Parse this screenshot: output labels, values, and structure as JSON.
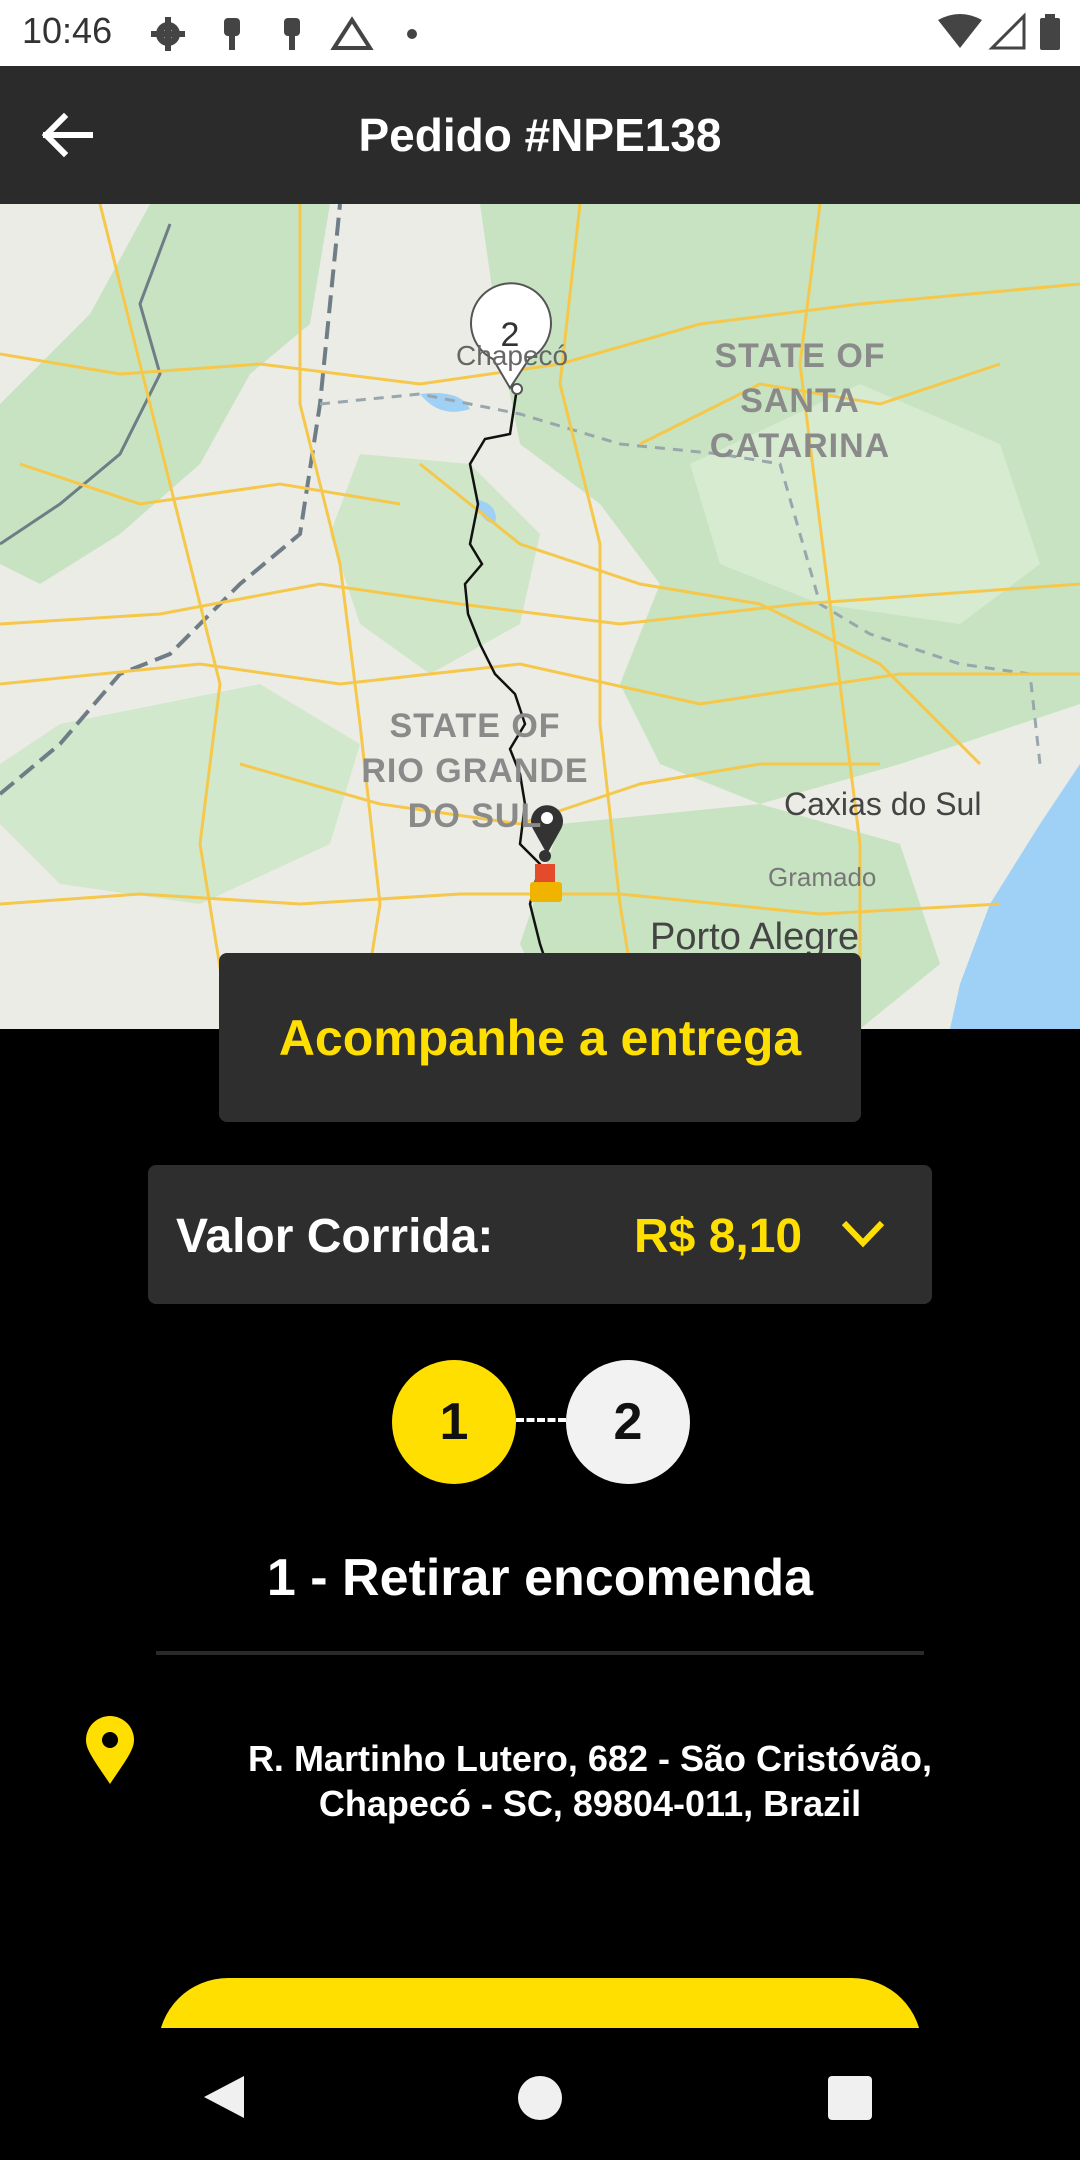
{
  "status_bar": {
    "time": "10:46",
    "icons_left": [
      "gear-icon",
      "notification-icon",
      "notification-icon",
      "drive-icon",
      "dot-icon"
    ],
    "icons_right": [
      "wifi-icon",
      "signal-icon",
      "battery-icon"
    ]
  },
  "app_bar": {
    "back_icon": "arrow-left-icon",
    "title": "Pedido #NPE138"
  },
  "map": {
    "labels": {
      "santa_catarina": "STATE OF\nSANTA\nCATARINA",
      "rio_grande": "STATE OF\nRIO GRANDE\nDO SUL",
      "chapeco": "Chapecó",
      "caxias": "Caxias do Sul",
      "gramado": "Gramado",
      "porto_alegre": "Porto Alegre"
    },
    "marker_number": "2",
    "colors": {
      "land": "#dfe5d8",
      "forest": "#c7e3c1",
      "water": "#9fd0f5",
      "road": "#f5c84c",
      "route": "#000000"
    }
  },
  "track_button": {
    "label": "Acompanhe a entrega"
  },
  "fare": {
    "label": "Valor Corrida:",
    "value": "R$ 8,10",
    "icon": "chevron-down-icon"
  },
  "steps": {
    "first": "1",
    "second": "2",
    "current_title": "1 - Retirar encomenda"
  },
  "address": {
    "icon": "location-pin-icon",
    "line1": "R. Martinho Lutero, 682 - São Cristóvão,",
    "line2": "Chapecó - SC, 89804-011, Brazil"
  },
  "nav_bar": {
    "back_icon": "nav-back-icon",
    "home_icon": "nav-home-icon",
    "recents_icon": "nav-recents-icon"
  },
  "colors": {
    "accent": "#ffdf00",
    "background": "#000000",
    "card": "#2e2e2e",
    "app_bar": "#2b2b2b"
  }
}
